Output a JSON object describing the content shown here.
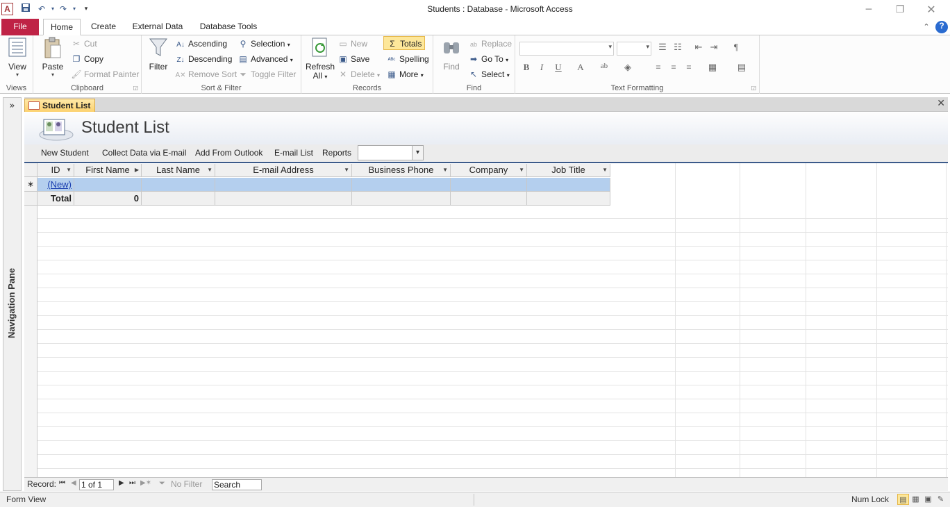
{
  "window": {
    "title": "Students : Database  -  Microsoft Access"
  },
  "ribbon_tabs": {
    "file": "File",
    "home": "Home",
    "create": "Create",
    "external": "External Data",
    "dbtools": "Database Tools"
  },
  "ribbon": {
    "views": {
      "view": "View",
      "group": "Views"
    },
    "clipboard": {
      "paste": "Paste",
      "cut": "Cut",
      "copy": "Copy",
      "format_painter": "Format Painter",
      "group": "Clipboard"
    },
    "sort_filter": {
      "filter": "Filter",
      "ascending": "Ascending",
      "descending": "Descending",
      "remove_sort": "Remove Sort",
      "selection": "Selection",
      "advanced": "Advanced",
      "toggle_filter": "Toggle Filter",
      "group": "Sort & Filter"
    },
    "records": {
      "refresh": "Refresh",
      "refresh_all": "All",
      "new": "New",
      "save": "Save",
      "delete": "Delete",
      "totals": "Totals",
      "spelling": "Spelling",
      "more": "More",
      "group": "Records"
    },
    "find": {
      "find": "Find",
      "replace": "Replace",
      "goto": "Go To",
      "select": "Select",
      "group": "Find"
    },
    "text_formatting": {
      "group": "Text Formatting",
      "bold": "B",
      "italic": "I",
      "underline": "U",
      "font_color": "A"
    }
  },
  "navpane": {
    "label": "Navigation Pane",
    "expand": "»"
  },
  "document": {
    "tab": "Student List",
    "form_title": "Student List",
    "form_buttons": {
      "new_student": "New Student",
      "collect_email": "Collect Data via E-mail",
      "add_outlook": "Add From Outlook",
      "email_list": "E-mail List",
      "reports": "Reports"
    },
    "reports_combo_value": ""
  },
  "grid": {
    "columns": [
      "ID",
      "First Name",
      "Last Name",
      "E-mail Address",
      "Business Phone",
      "Company",
      "Job Title"
    ],
    "new_row_marker": "∗",
    "new_row_id": "(New)",
    "total_label": "Total",
    "total_first_name": "0"
  },
  "record_nav": {
    "label": "Record:",
    "position": "1 of 1",
    "filter_status": "No Filter",
    "search_placeholder": "Search"
  },
  "status_bar": {
    "view": "Form View",
    "num_lock": "Num Lock"
  },
  "colors": {
    "file_tab": "#bf2346",
    "accent": "#3b5a8a",
    "new_row": "#b4cfee",
    "totals_highlight": "#fde79a"
  }
}
